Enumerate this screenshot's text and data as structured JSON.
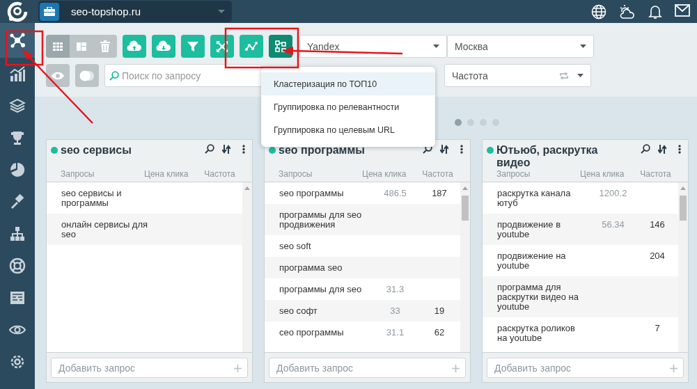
{
  "header": {
    "project": "seo-topshop.ru"
  },
  "sidebar": {
    "items": [
      {
        "selected": true
      },
      {
        "selected": false
      },
      {
        "selected": false
      },
      {
        "selected": false
      },
      {
        "selected": false
      },
      {
        "selected": false
      },
      {
        "selected": false
      },
      {
        "selected": false
      },
      {
        "selected": false
      },
      {
        "selected": false
      },
      {
        "selected": false
      }
    ]
  },
  "toolbar": {
    "view_buttons": [
      {
        "selected": true
      },
      {
        "selected": false
      },
      {
        "selected": false
      }
    ],
    "actions": [
      {
        "selected": false
      },
      {
        "selected": false
      },
      {
        "selected": false
      },
      {
        "selected": false
      },
      {
        "selected": false
      },
      {
        "selected": true
      }
    ],
    "search_engine": "Yandex",
    "region": "Москва",
    "search": {
      "placeholder": "Поиск по запросу"
    },
    "sort": "Частота"
  },
  "menu": {
    "items": [
      {
        "label": "Кластеризация по ТОП10",
        "selected": true
      },
      {
        "label": "Группировка по релевантности",
        "selected": false
      },
      {
        "label": "Группировка по целевым URL",
        "selected": false
      }
    ]
  },
  "pager": {
    "dots": [
      {
        "selected": true
      },
      {
        "selected": false
      },
      {
        "selected": false
      },
      {
        "selected": false
      }
    ]
  },
  "groups": [
    {
      "title": "seo сервисы",
      "columns": [
        "Запросы",
        "Цена клика",
        "Частота"
      ],
      "add_placeholder": "Добавить запрос",
      "rows": [
        {
          "query": "seo сервисы и программы"
        },
        {
          "query": "онлайн сервисы для seo"
        }
      ]
    },
    {
      "title": "seo программы",
      "columns": [
        "Запросы",
        "Цена клика",
        "Частота"
      ],
      "add_placeholder": "Добавить запрос",
      "rows": [
        {
          "query": "seo программы",
          "cpc": "486.5",
          "freq": "187"
        },
        {
          "query": "программы для seo продвижения"
        },
        {
          "query": "seo soft"
        },
        {
          "query": "программа seo"
        },
        {
          "query": "программы для seo",
          "cpc": "31.3"
        },
        {
          "query": "seo софт",
          "cpc": "33",
          "freq": "19"
        },
        {
          "query": "сео программы",
          "cpc": "31.1",
          "freq": "62"
        }
      ]
    },
    {
      "title": "Ютьюб, раскрутка видео",
      "columns": [
        "Запросы",
        "Цена клика",
        "Частота"
      ],
      "add_placeholder": "Добавить запрос",
      "rows": [
        {
          "query": "раскрутка канала ютуб",
          "cpc": "1200.2"
        },
        {
          "query": "продвижение в youtube",
          "cpc": "56.34",
          "freq": "146"
        },
        {
          "query": "продвижение на youtube",
          "freq": "204"
        },
        {
          "query": "программа для раскрутки видео на youtube"
        },
        {
          "query": "раскрутка роликов на youtube",
          "freq": "7"
        }
      ]
    }
  ]
}
